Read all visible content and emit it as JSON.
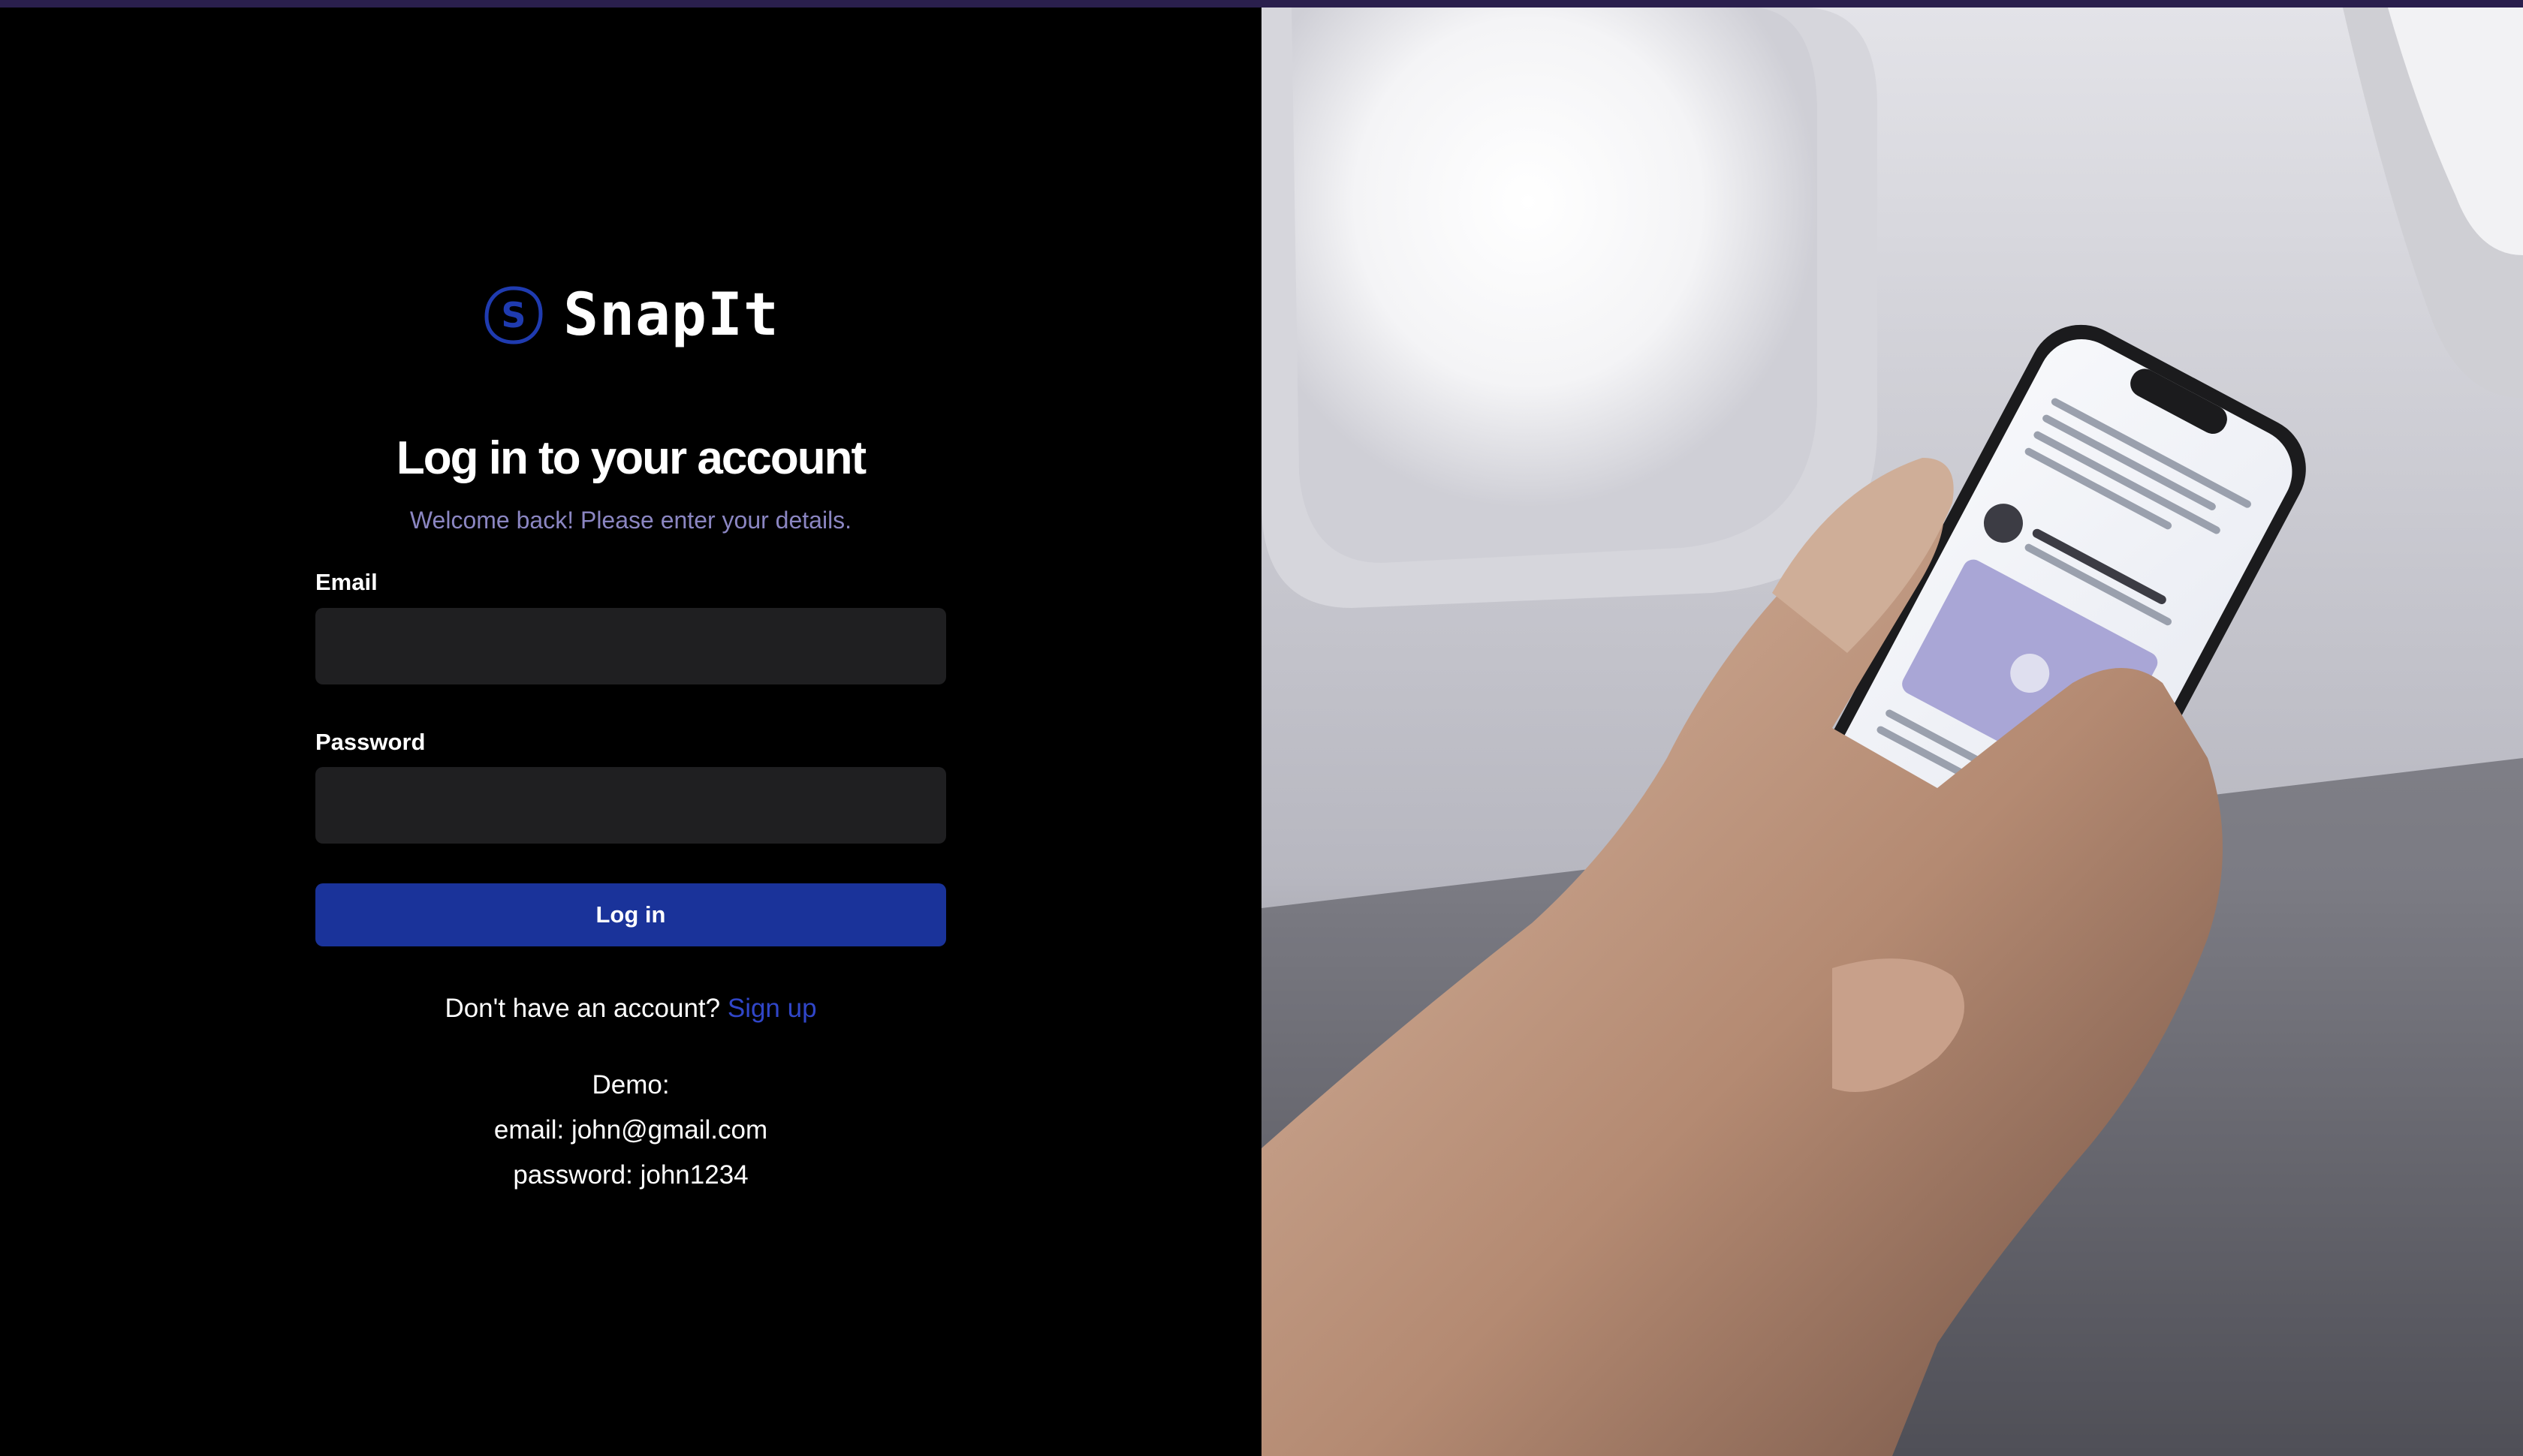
{
  "brand": {
    "name": "SnapIt",
    "icon": "snapit-logo-icon",
    "accent_color": "#1a339a"
  },
  "login": {
    "title": "Log in to your account",
    "subtitle": "Welcome back! Please enter your details.",
    "email_label": "Email",
    "email_value": "",
    "password_label": "Password",
    "password_value": "",
    "submit_label": "Log in",
    "signup_prompt": "Don't have an account?",
    "signup_link": "Sign up"
  },
  "demo": {
    "heading": "Demo:",
    "email_line": "email: john@gmail.com",
    "password_line": "password: john1234"
  },
  "hero_image": {
    "icon": "hand-holding-phone-photo"
  }
}
